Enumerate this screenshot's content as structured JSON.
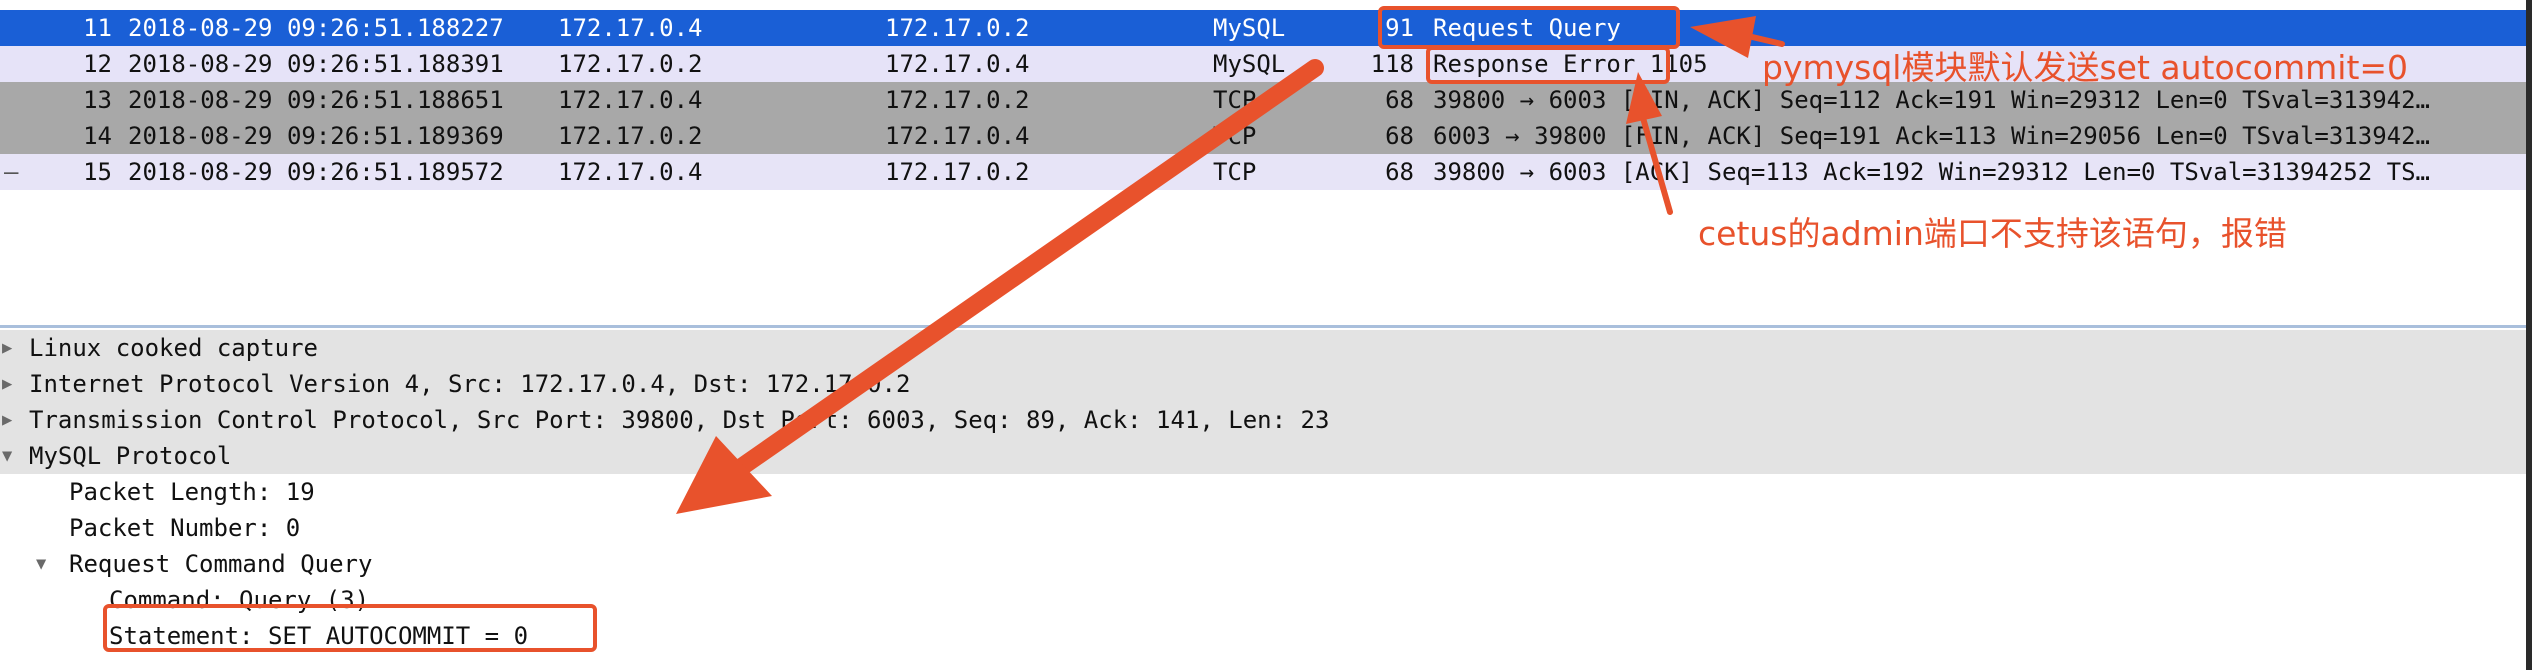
{
  "packets": [
    {
      "no": "11",
      "time": "2018-08-29 09:26:51.188227",
      "src": "172.17.0.4",
      "dst": "172.17.0.2",
      "proto": "MySQL",
      "len": "91",
      "info": "Request Query"
    },
    {
      "no": "12",
      "time": "2018-08-29 09:26:51.188391",
      "src": "172.17.0.2",
      "dst": "172.17.0.4",
      "proto": "MySQL",
      "len": "118",
      "info": "Response Error 1105"
    },
    {
      "no": "13",
      "time": "2018-08-29 09:26:51.188651",
      "src": "172.17.0.4",
      "dst": "172.17.0.2",
      "proto": "TCP",
      "len": "68",
      "info": "39800 → 6003 [FIN, ACK] Seq=112 Ack=191 Win=29312 Len=0 TSval=313942…"
    },
    {
      "no": "14",
      "time": "2018-08-29 09:26:51.189369",
      "src": "172.17.0.2",
      "dst": "172.17.0.4",
      "proto": "TCP",
      "len": "68",
      "info": "6003 → 39800 [FIN, ACK] Seq=191 Ack=113 Win=29056 Len=0 TSval=313942…"
    },
    {
      "no": "15",
      "time": "2018-08-29 09:26:51.189572",
      "src": "172.17.0.4",
      "dst": "172.17.0.2",
      "proto": "TCP",
      "len": "68",
      "info": "39800 → 6003 [ACK] Seq=113 Ack=192 Win=29312 Len=0 TSval=31394252 TS…"
    }
  ],
  "row15_marker": "–",
  "details": {
    "linux": "Linux cooked capture",
    "ip": "Internet Protocol Version 4, Src: 172.17.0.4, Dst: 172.17.0.2",
    "tcp": "Transmission Control Protocol, Src Port: 39800, Dst Port: 6003, Seq: 89, Ack: 141, Len: 23",
    "mysql": "MySQL Protocol",
    "packet_length": "Packet Length: 19",
    "packet_number": "Packet Number: 0",
    "request": "Request Command Query",
    "command": "Command: Query (3)",
    "statement": "Statement: SET AUTOCOMMIT = 0"
  },
  "annotations": {
    "pymysql_note": "pymysql模块默认发送set autocommit=0",
    "cetus_note": "cetus的admin端口不支持该语句，报错",
    "color": "#e8522c"
  },
  "colors": {
    "selected_row": "#1a5fd6",
    "mysql_row": "#e6e3f8",
    "tcp_row": "#a8a8a8",
    "shaded_detail": "#e3e3e3"
  },
  "icons": {
    "collapsed": "triangle-right-icon",
    "expanded": "triangle-down-icon"
  }
}
